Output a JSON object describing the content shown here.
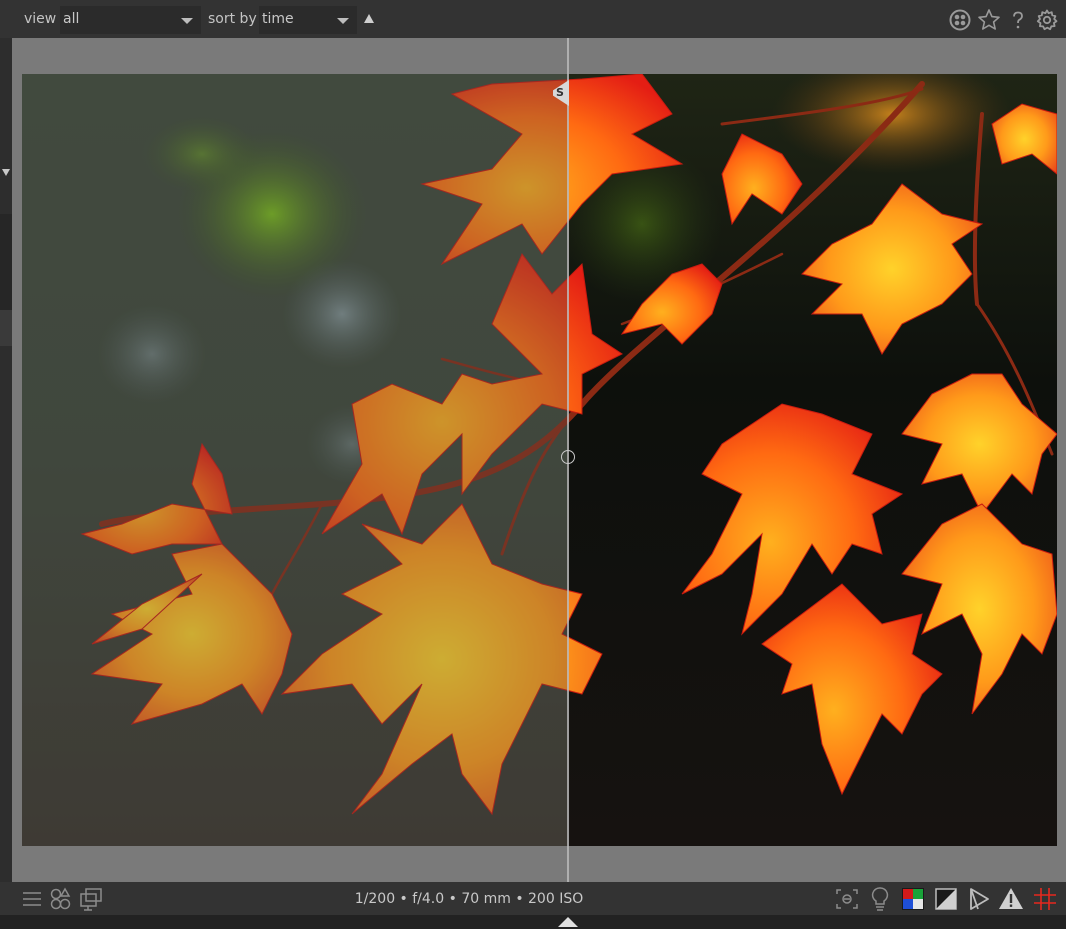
{
  "toolbar": {
    "view_label": "view",
    "view_value": "all",
    "sort_label": "sort by",
    "sort_value": "time",
    "sort_direction": "ascending",
    "icons": [
      "color-labels-icon",
      "star-icon",
      "help-icon",
      "settings-icon"
    ]
  },
  "image": {
    "split_badge": "S"
  },
  "bottom_bar": {
    "exif": "1/200 • f/4.0 • 70 mm • 200 ISO",
    "left_icons": [
      "menu-icon",
      "styles-icon",
      "second-window-icon"
    ],
    "right_icons": [
      "focus-peaking-icon",
      "bulb-icon",
      "color-assessment-icon",
      "softproof-icon",
      "gamut-check-icon",
      "overexposure-warning-icon",
      "guides-icon"
    ]
  },
  "colors": {
    "toolbar_bg": "#333333",
    "center_bg": "#7a7a7a",
    "leaf_red": "#e8381c",
    "leaf_orange": "#ff8a1a",
    "leaf_yellow": "#ffc21e"
  }
}
